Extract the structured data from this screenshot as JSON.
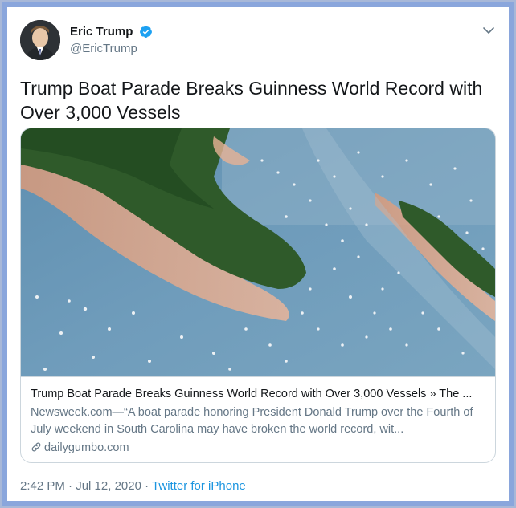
{
  "user": {
    "display_name": "Eric Trump",
    "handle": "@EricTrump",
    "verified": true
  },
  "tweet": {
    "text": "Trump Boat Parade Breaks Guinness World Record with Over 3,000 Vessels"
  },
  "link_card": {
    "title": "Trump Boat Parade Breaks Guinness World Record with Over 3,000 Vessels » The ...",
    "description": "Newsweek.com—“A boat parade honoring President Donald Trump over the Fourth of July weekend in South Carolina may have broken the world record, wit...",
    "domain": "dailygumbo.com"
  },
  "meta": {
    "time": "2:42 PM",
    "separator": "·",
    "date": "Jul 12, 2020",
    "source": "Twitter for iPhone"
  },
  "colors": {
    "brand": "#1da1f2",
    "link": "#1b95e0",
    "text": "#14171a",
    "secondary": "#657786",
    "border": "#ccd6dd"
  },
  "icons": {
    "verified": "verified-badge-icon",
    "chevron": "chevron-down-icon",
    "link": "link-icon"
  }
}
